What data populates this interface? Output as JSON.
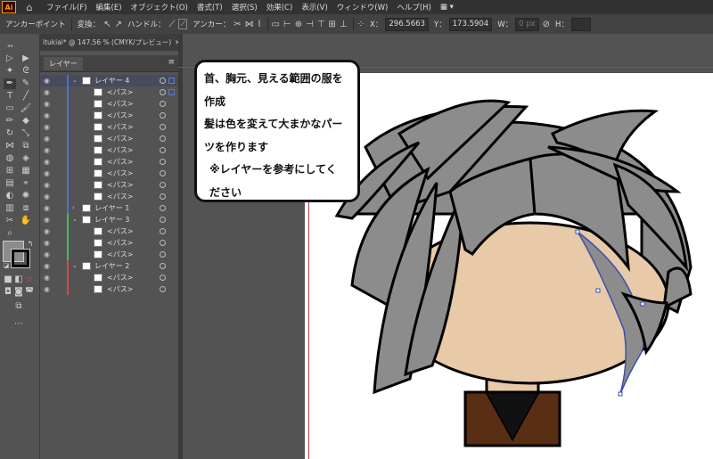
{
  "app": {
    "logo": "Ai",
    "home_icon": "home-icon"
  },
  "menu": [
    "ファイル(F)",
    "編集(E)",
    "オブジェクト(O)",
    "書式(T)",
    "選択(S)",
    "効果(C)",
    "表示(V)",
    "ウィンドウ(W)",
    "ヘルプ(H)"
  ],
  "control": {
    "tool_name": "アンカーポイント",
    "convert": "変換：",
    "handle": "ハンドル：",
    "anchor": "アンカー：",
    "x_label": "X：",
    "x_value": "296.5663",
    "y_label": "Y：",
    "y_value": "173.5904",
    "w_label": "W：",
    "w_value": "0 px",
    "h_label": "H："
  },
  "document": {
    "tab": "itukiai* @ 147.56 % (CMYK/プレビュー)"
  },
  "layers_panel": {
    "tab": "レイヤー",
    "rows": [
      {
        "type": "layer",
        "name": "レイヤー 4",
        "color": "#4f6fd6"
      },
      {
        "type": "path",
        "name": "<パス>"
      },
      {
        "type": "path",
        "name": "<パス>"
      },
      {
        "type": "path",
        "name": "<パス>"
      },
      {
        "type": "path",
        "name": "<パス>"
      },
      {
        "type": "path",
        "name": "<パス>"
      },
      {
        "type": "path",
        "name": "<パス>"
      },
      {
        "type": "path",
        "name": "<パス>"
      },
      {
        "type": "path",
        "name": "<パス>"
      },
      {
        "type": "path",
        "name": "<パス>"
      },
      {
        "type": "path",
        "name": "<パス>"
      },
      {
        "type": "layer",
        "name": "レイヤー 1",
        "color": "#4f6fd6"
      },
      {
        "type": "layer",
        "name": "レイヤー 3",
        "color": "#3fbf5a"
      },
      {
        "type": "path",
        "name": "<パス>"
      },
      {
        "type": "path",
        "name": "<パス>"
      },
      {
        "type": "path",
        "name": "<パス>"
      },
      {
        "type": "layer",
        "name": "レイヤー 2",
        "color": "#d04a4a"
      },
      {
        "type": "path",
        "name": "<パス>"
      },
      {
        "type": "path",
        "name": "<パス>"
      }
    ]
  },
  "callout": {
    "lines": [
      "首、胸元、見える範囲の服を",
      "作成",
      "髪は色を変えて大まかなパー",
      "ツを作ります",
      "※レイヤーを参考にしてく",
      "ださい"
    ]
  },
  "colors": {
    "hair": "#8c8c8c",
    "skin": "#e8c9a8",
    "shirt": "#5a2e14",
    "selection": "#3b4fb0"
  }
}
